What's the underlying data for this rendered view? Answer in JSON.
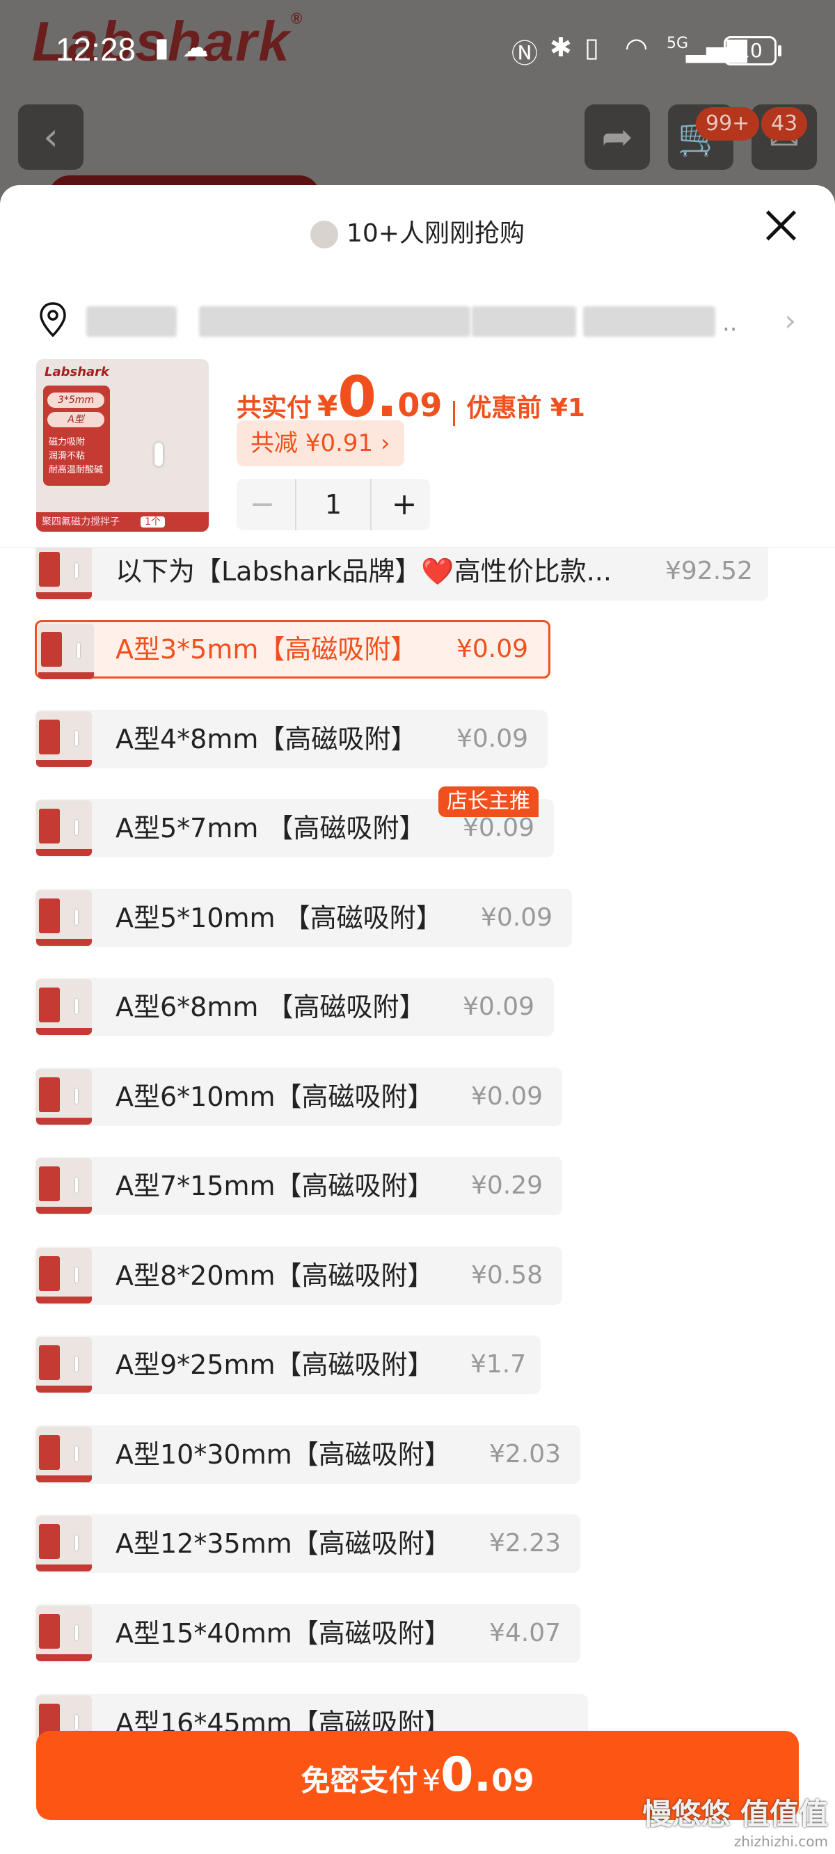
{
  "status_bar": {
    "time": "12:28",
    "battery": "10",
    "network": "5G"
  },
  "background": {
    "logo": "Labshark",
    "cart_badge": "99+",
    "msg_badge": "43"
  },
  "sheet": {
    "hot_text": "10+人刚刚抢购",
    "address_more": "..",
    "product_thumb": {
      "brand": "Labshark",
      "size_chip": "3*5mm",
      "type_chip": "A型",
      "features": [
        "磁力吸附",
        "润滑不粘",
        "耐高温耐酸碱"
      ],
      "bottom_text": "聚四氟磁力搅拌子",
      "bottom_tag": "1个"
    },
    "price": {
      "label": "共实付",
      "currency": "¥",
      "int": "0.",
      "dec": "09",
      "original": "优惠前 ¥1"
    },
    "discount": "共减 ¥0.91 ›",
    "quantity": {
      "minus": "−",
      "value": "1",
      "plus": "+"
    },
    "recommend_badge": "店长主推",
    "options": [
      {
        "name": "以下为【Labshark品牌】❤️高性价比款...",
        "price": "¥92.52"
      },
      {
        "name": "A型3*5mm【高磁吸附】",
        "price": "¥0.09"
      },
      {
        "name": "A型4*8mm【高磁吸附】",
        "price": "¥0.09"
      },
      {
        "name": "A型5*7mm 【高磁吸附】",
        "price": "¥0.09"
      },
      {
        "name": "A型5*10mm 【高磁吸附】",
        "price": "¥0.09"
      },
      {
        "name": "A型6*8mm 【高磁吸附】",
        "price": "¥0.09"
      },
      {
        "name": "A型6*10mm【高磁吸附】",
        "price": "¥0.09"
      },
      {
        "name": "A型7*15mm【高磁吸附】",
        "price": "¥0.29"
      },
      {
        "name": "A型8*20mm【高磁吸附】",
        "price": "¥0.58"
      },
      {
        "name": "A型9*25mm【高磁吸附】",
        "price": "¥1.7"
      },
      {
        "name": "A型10*30mm【高磁吸附】",
        "price": "¥2.03"
      },
      {
        "name": "A型12*35mm【高磁吸附】",
        "price": "¥2.23"
      },
      {
        "name": "A型15*40mm【高磁吸附】",
        "price": "¥4.07"
      },
      {
        "name": "A型16*45mm【高磁吸附】",
        "price": ""
      }
    ],
    "selected_index": 1,
    "pay_button": {
      "label": "免密支付",
      "currency": "¥",
      "int": "0.",
      "dec": "09"
    }
  },
  "watermark": {
    "main": "慢悠悠 值值值",
    "sub": "zhizhizhi.com"
  },
  "colors": {
    "accent": "#fd5514",
    "price": "#f0501e",
    "selected_bg": "#fff0ea"
  }
}
